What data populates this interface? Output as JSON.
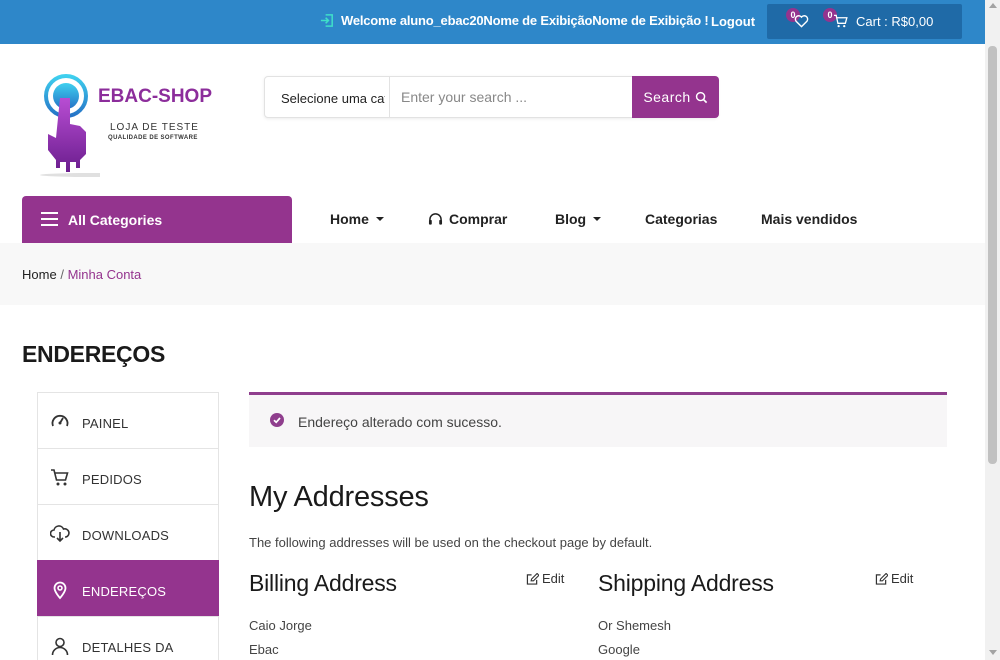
{
  "topbar": {
    "welcome": "Welcome aluno_ebac20Nome de ExibiçãoNome de Exibição !",
    "logout": "Logout",
    "wishlist_count": "0",
    "cart_count": "0",
    "cart_label": "Cart : R$0,00"
  },
  "logo": {
    "title": "EBAC-SHOP",
    "subtitle": "LOJA DE TESTE",
    "tagline": "QUALIDADE DE SOFTWARE"
  },
  "search": {
    "category": "Selecione uma categoria",
    "placeholder": "Enter your search ...",
    "button": "Search"
  },
  "nav": {
    "all_categories": "All Categories",
    "items": [
      {
        "label": "Home"
      },
      {
        "label": "Comprar"
      },
      {
        "label": "Blog"
      },
      {
        "label": "Categorias"
      },
      {
        "label": "Mais vendidos"
      }
    ]
  },
  "breadcrumb": {
    "home": "Home",
    "separator": "/",
    "current": "Minha Conta"
  },
  "page_title": "ENDEREÇOS",
  "sidebar": {
    "items": [
      {
        "label": "PAINEL",
        "icon": "dashboard-gauge-icon"
      },
      {
        "label": "PEDIDOS",
        "icon": "cart-icon"
      },
      {
        "label": "DOWNLOADS",
        "icon": "cloud-download-icon"
      },
      {
        "label": "ENDEREÇOS",
        "icon": "location-pin-icon",
        "active": true
      },
      {
        "label": "DETALHES DA",
        "icon": "user-icon"
      }
    ]
  },
  "notice": {
    "message": "Endereço alterado com sucesso."
  },
  "addresses": {
    "heading": "My Addresses",
    "intro": "The following addresses will be used on the checkout page by default.",
    "billing": {
      "heading": "Billing Address",
      "edit": "Edit",
      "lines": [
        "Caio Jorge",
        "Ebac"
      ]
    },
    "shipping": {
      "heading": "Shipping Address",
      "edit": "Edit",
      "lines": [
        "Or Shemesh",
        "Google"
      ]
    }
  },
  "colors": {
    "topbar": "#2e87c9",
    "accent": "#94348e",
    "cart_box": "#1f6aa7"
  }
}
